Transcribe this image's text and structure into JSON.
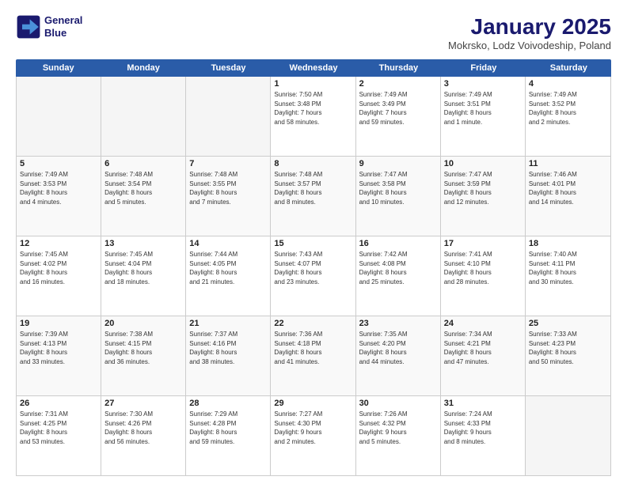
{
  "header": {
    "logo_line1": "General",
    "logo_line2": "Blue",
    "title": "January 2025",
    "subtitle": "Mokrsko, Lodz Voivodeship, Poland"
  },
  "days_of_week": [
    "Sunday",
    "Monday",
    "Tuesday",
    "Wednesday",
    "Thursday",
    "Friday",
    "Saturday"
  ],
  "rows": [
    [
      {
        "day": "",
        "info": "",
        "empty": true
      },
      {
        "day": "",
        "info": "",
        "empty": true
      },
      {
        "day": "",
        "info": "",
        "empty": true
      },
      {
        "day": "1",
        "info": "Sunrise: 7:50 AM\nSunset: 3:48 PM\nDaylight: 7 hours\nand 58 minutes.",
        "empty": false
      },
      {
        "day": "2",
        "info": "Sunrise: 7:49 AM\nSunset: 3:49 PM\nDaylight: 7 hours\nand 59 minutes.",
        "empty": false
      },
      {
        "day": "3",
        "info": "Sunrise: 7:49 AM\nSunset: 3:51 PM\nDaylight: 8 hours\nand 1 minute.",
        "empty": false
      },
      {
        "day": "4",
        "info": "Sunrise: 7:49 AM\nSunset: 3:52 PM\nDaylight: 8 hours\nand 2 minutes.",
        "empty": false
      }
    ],
    [
      {
        "day": "5",
        "info": "Sunrise: 7:49 AM\nSunset: 3:53 PM\nDaylight: 8 hours\nand 4 minutes.",
        "empty": false
      },
      {
        "day": "6",
        "info": "Sunrise: 7:48 AM\nSunset: 3:54 PM\nDaylight: 8 hours\nand 5 minutes.",
        "empty": false
      },
      {
        "day": "7",
        "info": "Sunrise: 7:48 AM\nSunset: 3:55 PM\nDaylight: 8 hours\nand 7 minutes.",
        "empty": false
      },
      {
        "day": "8",
        "info": "Sunrise: 7:48 AM\nSunset: 3:57 PM\nDaylight: 8 hours\nand 8 minutes.",
        "empty": false
      },
      {
        "day": "9",
        "info": "Sunrise: 7:47 AM\nSunset: 3:58 PM\nDaylight: 8 hours\nand 10 minutes.",
        "empty": false
      },
      {
        "day": "10",
        "info": "Sunrise: 7:47 AM\nSunset: 3:59 PM\nDaylight: 8 hours\nand 12 minutes.",
        "empty": false
      },
      {
        "day": "11",
        "info": "Sunrise: 7:46 AM\nSunset: 4:01 PM\nDaylight: 8 hours\nand 14 minutes.",
        "empty": false
      }
    ],
    [
      {
        "day": "12",
        "info": "Sunrise: 7:45 AM\nSunset: 4:02 PM\nDaylight: 8 hours\nand 16 minutes.",
        "empty": false
      },
      {
        "day": "13",
        "info": "Sunrise: 7:45 AM\nSunset: 4:04 PM\nDaylight: 8 hours\nand 18 minutes.",
        "empty": false
      },
      {
        "day": "14",
        "info": "Sunrise: 7:44 AM\nSunset: 4:05 PM\nDaylight: 8 hours\nand 21 minutes.",
        "empty": false
      },
      {
        "day": "15",
        "info": "Sunrise: 7:43 AM\nSunset: 4:07 PM\nDaylight: 8 hours\nand 23 minutes.",
        "empty": false
      },
      {
        "day": "16",
        "info": "Sunrise: 7:42 AM\nSunset: 4:08 PM\nDaylight: 8 hours\nand 25 minutes.",
        "empty": false
      },
      {
        "day": "17",
        "info": "Sunrise: 7:41 AM\nSunset: 4:10 PM\nDaylight: 8 hours\nand 28 minutes.",
        "empty": false
      },
      {
        "day": "18",
        "info": "Sunrise: 7:40 AM\nSunset: 4:11 PM\nDaylight: 8 hours\nand 30 minutes.",
        "empty": false
      }
    ],
    [
      {
        "day": "19",
        "info": "Sunrise: 7:39 AM\nSunset: 4:13 PM\nDaylight: 8 hours\nand 33 minutes.",
        "empty": false
      },
      {
        "day": "20",
        "info": "Sunrise: 7:38 AM\nSunset: 4:15 PM\nDaylight: 8 hours\nand 36 minutes.",
        "empty": false
      },
      {
        "day": "21",
        "info": "Sunrise: 7:37 AM\nSunset: 4:16 PM\nDaylight: 8 hours\nand 38 minutes.",
        "empty": false
      },
      {
        "day": "22",
        "info": "Sunrise: 7:36 AM\nSunset: 4:18 PM\nDaylight: 8 hours\nand 41 minutes.",
        "empty": false
      },
      {
        "day": "23",
        "info": "Sunrise: 7:35 AM\nSunset: 4:20 PM\nDaylight: 8 hours\nand 44 minutes.",
        "empty": false
      },
      {
        "day": "24",
        "info": "Sunrise: 7:34 AM\nSunset: 4:21 PM\nDaylight: 8 hours\nand 47 minutes.",
        "empty": false
      },
      {
        "day": "25",
        "info": "Sunrise: 7:33 AM\nSunset: 4:23 PM\nDaylight: 8 hours\nand 50 minutes.",
        "empty": false
      }
    ],
    [
      {
        "day": "26",
        "info": "Sunrise: 7:31 AM\nSunset: 4:25 PM\nDaylight: 8 hours\nand 53 minutes.",
        "empty": false
      },
      {
        "day": "27",
        "info": "Sunrise: 7:30 AM\nSunset: 4:26 PM\nDaylight: 8 hours\nand 56 minutes.",
        "empty": false
      },
      {
        "day": "28",
        "info": "Sunrise: 7:29 AM\nSunset: 4:28 PM\nDaylight: 8 hours\nand 59 minutes.",
        "empty": false
      },
      {
        "day": "29",
        "info": "Sunrise: 7:27 AM\nSunset: 4:30 PM\nDaylight: 9 hours\nand 2 minutes.",
        "empty": false
      },
      {
        "day": "30",
        "info": "Sunrise: 7:26 AM\nSunset: 4:32 PM\nDaylight: 9 hours\nand 5 minutes.",
        "empty": false
      },
      {
        "day": "31",
        "info": "Sunrise: 7:24 AM\nSunset: 4:33 PM\nDaylight: 9 hours\nand 8 minutes.",
        "empty": false
      },
      {
        "day": "",
        "info": "",
        "empty": true
      }
    ]
  ]
}
